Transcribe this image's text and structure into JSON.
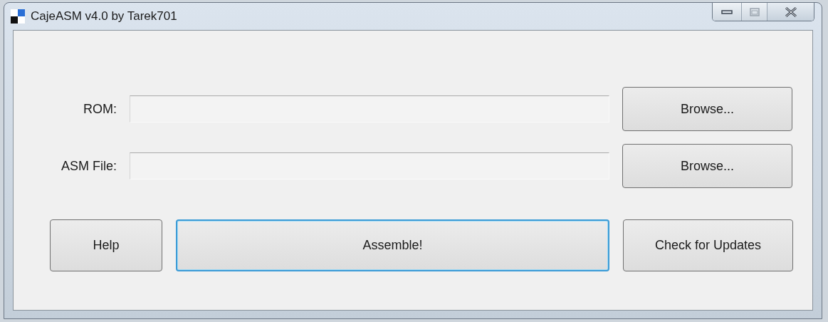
{
  "window": {
    "title": "CajeASM v4.0 by Tarek701",
    "controls": [
      {
        "kind": "minimize",
        "disabled": false
      },
      {
        "kind": "maximize",
        "disabled": true
      },
      {
        "kind": "close",
        "disabled": false
      }
    ]
  },
  "fields": [
    {
      "label": "ROM:",
      "button": "Browse..."
    },
    {
      "label": "ASM File:",
      "button": "Browse..."
    }
  ],
  "actions": [
    {
      "label": "Help",
      "focused": false
    },
    {
      "label": "Assemble!",
      "focused": true
    },
    {
      "label": "Check for Updates",
      "focused": false
    }
  ]
}
